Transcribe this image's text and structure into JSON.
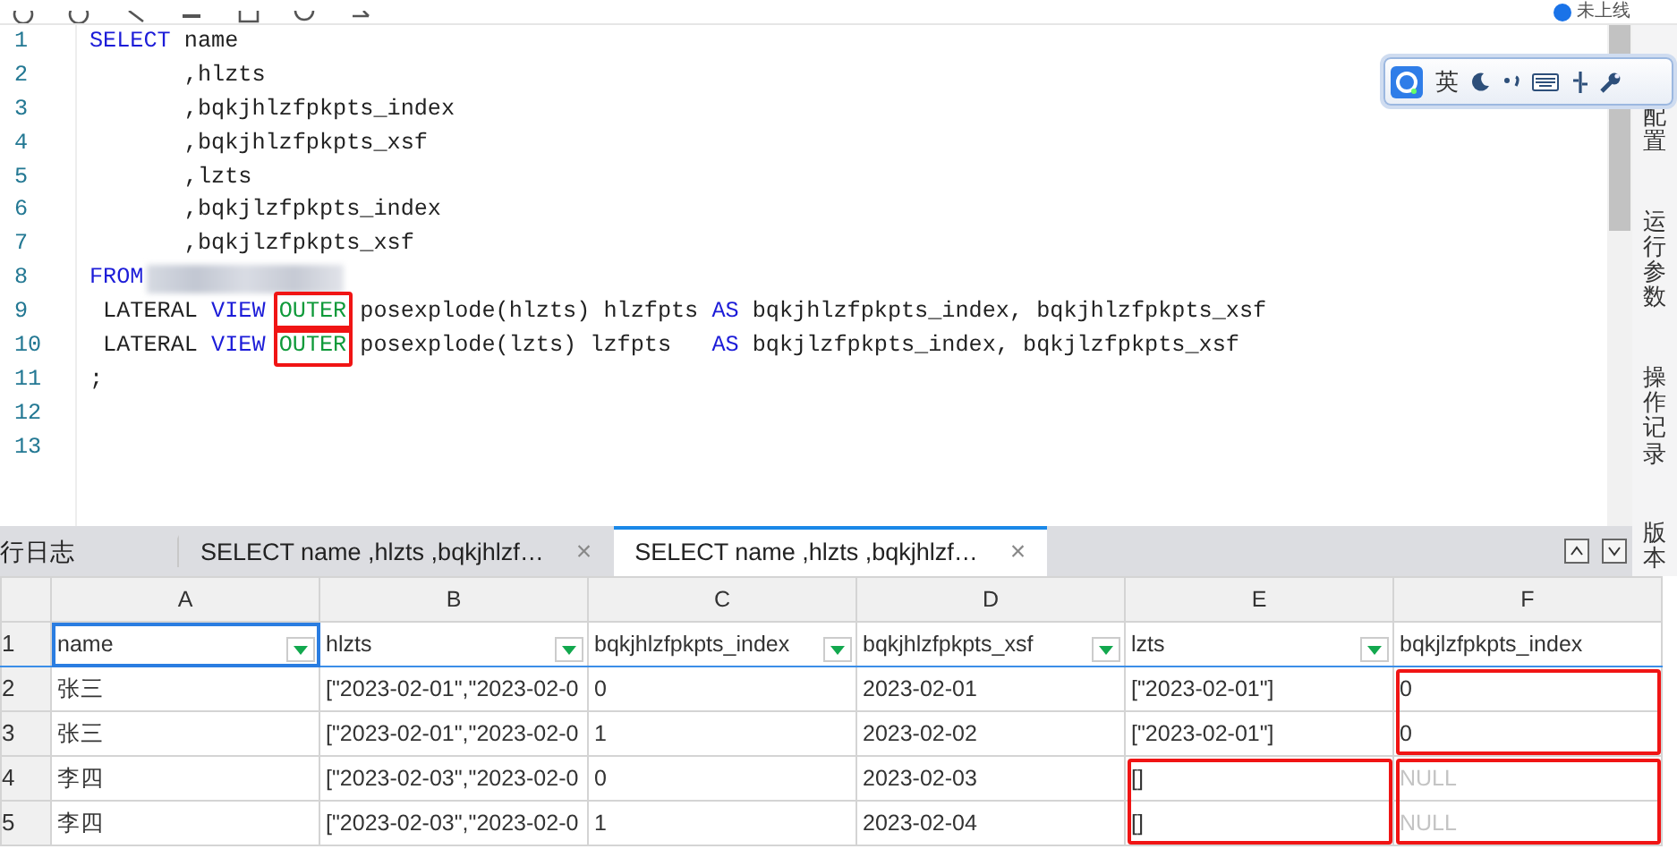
{
  "toolbar": {
    "status": "未上线"
  },
  "editor": {
    "lines": [
      {
        "number": "1",
        "tokens": [
          {
            "kind": "keyword",
            "text": "SELECT"
          },
          {
            "kind": "plain",
            "text": " name"
          }
        ]
      },
      {
        "number": "2",
        "tokens": [
          {
            "kind": "plain",
            "text": "       ,hlzts"
          }
        ]
      },
      {
        "number": "3",
        "tokens": [
          {
            "kind": "plain",
            "text": "       ,bqkjhlzfpkpts_index"
          }
        ]
      },
      {
        "number": "4",
        "tokens": [
          {
            "kind": "plain",
            "text": "       ,bqkjhlzfpkpts_xsf"
          }
        ]
      },
      {
        "number": "5",
        "tokens": [
          {
            "kind": "plain",
            "text": "       ,lzts"
          }
        ]
      },
      {
        "number": "6",
        "tokens": [
          {
            "kind": "plain",
            "text": "       ,bqkjlzfpkpts_index"
          }
        ]
      },
      {
        "number": "7",
        "tokens": [
          {
            "kind": "plain",
            "text": "       ,bqkjlzfpkpts_xsf"
          }
        ]
      },
      {
        "number": "8",
        "tokens": [
          {
            "kind": "keyword",
            "text": "FROM"
          },
          {
            "kind": "redacted"
          }
        ]
      },
      {
        "number": "9",
        "tokens": [
          {
            "kind": "plain",
            "text": " LATERAL "
          },
          {
            "kind": "keyword",
            "text": "VIEW "
          },
          {
            "kind": "modifier",
            "text": "OUTER",
            "boxed": true
          },
          {
            "kind": "plain",
            "text": " posexplode(hlzts) hlzfpts "
          },
          {
            "kind": "keyword",
            "text": "AS"
          },
          {
            "kind": "plain",
            "text": " bqkjhlzfpkpts_index, bqkjhlzfpkpts_xsf"
          }
        ]
      },
      {
        "number": "10",
        "tokens": [
          {
            "kind": "plain",
            "text": " LATERAL "
          },
          {
            "kind": "keyword",
            "text": "VIEW "
          },
          {
            "kind": "modifier",
            "text": "OUTER",
            "boxed": true
          },
          {
            "kind": "plain",
            "text": " posexplode(lzts) lzfpts   "
          },
          {
            "kind": "keyword",
            "text": "AS"
          },
          {
            "kind": "plain",
            "text": " bqkjlzfpkpts_index, bqkjlzfpkpts_xsf"
          }
        ]
      },
      {
        "number": "11",
        "tokens": [
          {
            "kind": "plain",
            "text": ";"
          }
        ]
      },
      {
        "number": "12"
      },
      {
        "number": "13"
      }
    ]
  },
  "ime_toolbar": {
    "language": "英"
  },
  "side_panel": {
    "items": [
      "配置",
      "运行参数",
      "操作记录",
      "版本"
    ]
  },
  "result_tabs": [
    {
      "label": "行日志",
      "selected": false
    },
    {
      "label": "SELECT name ,hlzts ,bqkjhlzf…",
      "selected": false,
      "close": "×"
    },
    {
      "label": "SELECT name ,hlzts ,bqkjhlzf…",
      "selected": true,
      "close": "×"
    }
  ],
  "grid": {
    "columns": [
      "A",
      "B",
      "C",
      "D",
      "E",
      "F"
    ],
    "rows": [
      {
        "number": "1",
        "kind": "header",
        "cells": [
          {
            "text": "name",
            "filter": true,
            "selected": true
          },
          {
            "text": "hlzts",
            "filter": true,
            "selected": false
          },
          {
            "text": "bqkjhlzfpkpts_index",
            "filter": true,
            "selected": false
          },
          {
            "text": "bqkjhlzfpkpts_xsf",
            "filter": true,
            "selected": false
          },
          {
            "text": "lzts",
            "filter": true,
            "selected": false
          },
          {
            "text": "bqkjlzfpkpts_index",
            "selected": false
          }
        ]
      },
      {
        "number": "2",
        "kind": "data",
        "cells": [
          {
            "text": "张三",
            "selected": false
          },
          {
            "text": "[\"2023-02-01\",\"2023-02-0",
            "selected": false
          },
          {
            "text": "0",
            "selected": false
          },
          {
            "text": "2023-02-01",
            "selected": false
          },
          {
            "text": "[\"2023-02-01\"]",
            "selected": false
          },
          {
            "text": "0",
            "selected": false,
            "outline_start": true
          }
        ]
      },
      {
        "number": "3",
        "kind": "data",
        "cells": [
          {
            "text": "张三",
            "selected": false
          },
          {
            "text": "[\"2023-02-01\",\"2023-02-0",
            "selected": false
          },
          {
            "text": "1",
            "selected": false
          },
          {
            "text": "2023-02-02",
            "selected": false
          },
          {
            "text": "[\"2023-02-01\"]",
            "selected": false
          },
          {
            "text": "0",
            "selected": false,
            "outline_end": true
          }
        ]
      },
      {
        "number": "4",
        "kind": "data",
        "cells": [
          {
            "text": "李四",
            "selected": false
          },
          {
            "text": "[\"2023-02-03\",\"2023-02-0",
            "selected": false
          },
          {
            "text": "0",
            "selected": false
          },
          {
            "text": "2023-02-03",
            "selected": false
          },
          {
            "text": "[]",
            "selected": false,
            "outline_start": true
          },
          {
            "text": "NULL",
            "null": true,
            "selected": false,
            "outline_start": true
          }
        ]
      },
      {
        "number": "5",
        "kind": "data",
        "cells": [
          {
            "text": "李四",
            "selected": false
          },
          {
            "text": "[\"2023-02-03\",\"2023-02-0",
            "selected": false
          },
          {
            "text": "1",
            "selected": false
          },
          {
            "text": "2023-02-04",
            "selected": false
          },
          {
            "text": "[]",
            "selected": false,
            "outline_end": true
          },
          {
            "text": "NULL",
            "null": true,
            "selected": false,
            "outline_end": true
          }
        ]
      }
    ]
  }
}
